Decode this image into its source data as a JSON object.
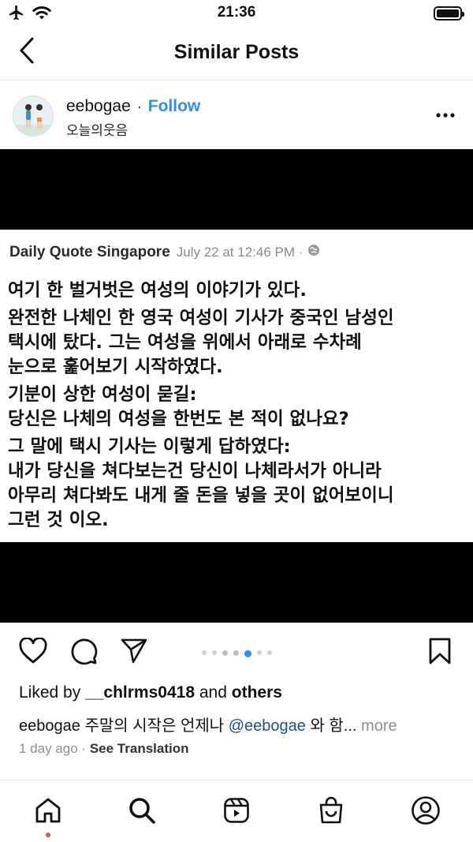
{
  "status_bar": {
    "time": "21:36"
  },
  "header": {
    "title": "Similar Posts"
  },
  "post": {
    "username": "eebogae",
    "separator": "·",
    "follow_label": "Follow",
    "subtitle": "오늘의웃음"
  },
  "quote": {
    "source_name": "Daily Quote Singapore",
    "source_date": "July 22 at 12:46 PM ·",
    "lines": [
      "여기 한 벌거벗은 여성의 이야기가 있다.",
      "완전한 나체인 한 영국 여성이 기사가 중국인 남성인",
      "택시에 탔다. 그는 여성을 위에서 아래로 수차례",
      "눈으로 훑어보기 시작하였다.",
      "기분이 상한 여성이 묻길:",
      "당신은 나체의 여성을 한번도 본 적이 없나요?",
      "그 말에 택시 기사는 이렇게 답하였다:",
      "내가 당신을 쳐다보는건 당신이 나체라서가 아니라",
      "아무리 쳐다봐도 내게 줄 돈을 넣을 곳이 없어보이니",
      "그런 것 이오."
    ]
  },
  "carousel": {
    "count": 7,
    "active_index": 4
  },
  "likes": {
    "prefix": "Liked by",
    "user": "__chlrms0418",
    "middle": "and",
    "suffix": "others"
  },
  "caption": {
    "user": "eebogae",
    "text": "주말의 시작은 언제나",
    "mention": "@eebogae",
    "tail": "와 함...",
    "more": "more"
  },
  "meta": {
    "time_ago": "1 day ago",
    "separator": "·",
    "see_translation": "See Translation"
  },
  "icons": {
    "back": "chevron-left-icon",
    "more": "more-horizontal-icon",
    "like": "heart-icon",
    "comment": "comment-icon",
    "share": "send-icon",
    "save": "bookmark-icon",
    "nav": [
      "home-icon",
      "search-icon",
      "reels-icon",
      "shop-icon",
      "profile-icon"
    ]
  },
  "colors": {
    "accent": "#2f8fe8",
    "mention": "#1f4e8c",
    "notification_dot": "#ed4956"
  }
}
